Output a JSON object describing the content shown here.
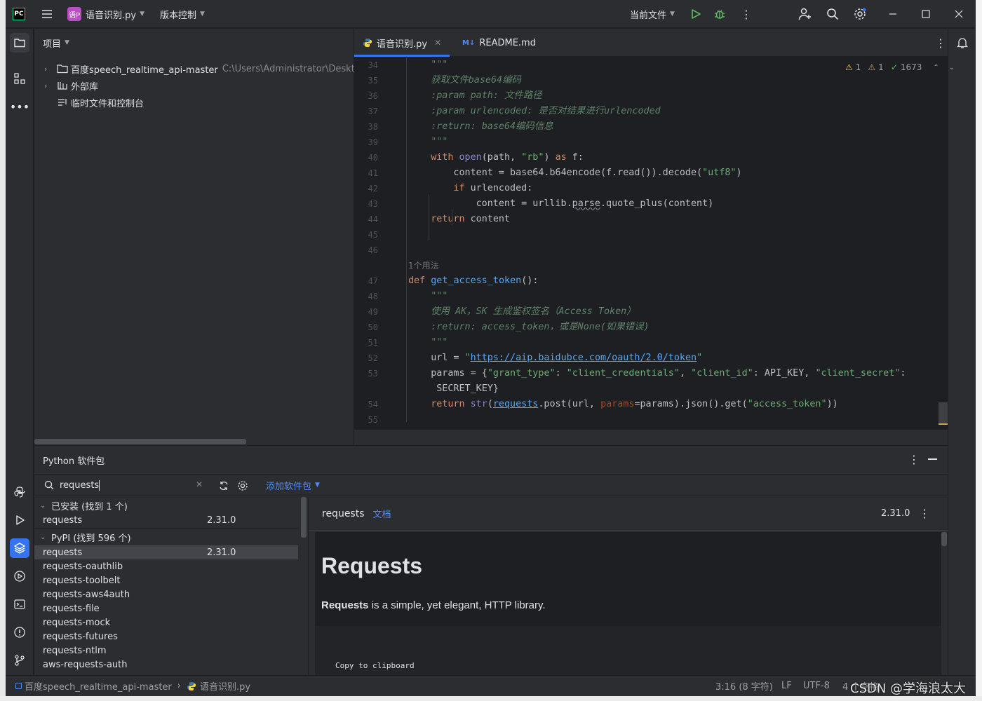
{
  "titlebar": {
    "app_icon": "pycharm-logo",
    "project_badge": "语P",
    "file_title": "语音识别.py",
    "vcs_menu": "版本控制",
    "run_config": "当前文件"
  },
  "project_panel": {
    "title": "项目",
    "tree": [
      {
        "label": "百度speech_realtime_api-master",
        "path": "C:\\Users\\Administrator\\Desktop"
      },
      {
        "label": "外部库"
      },
      {
        "label": "临时文件和控制台"
      }
    ]
  },
  "editor": {
    "tabs": [
      {
        "label": "语音识别.py"
      },
      {
        "label": "README.md"
      }
    ],
    "inspections": {
      "warnings": "1",
      "weak_warnings": "1",
      "ok": "1673"
    },
    "usage_hint": "1个用法",
    "lines": [
      {
        "n": "34",
        "text": "\"\"\""
      },
      {
        "n": "35",
        "text": "获取文件base64编码"
      },
      {
        "n": "36",
        "text": ":param path: 文件路径"
      },
      {
        "n": "37",
        "text": ":param urlencoded: 是否对结果进行urlencoded"
      },
      {
        "n": "38",
        "text": ":return: base64编码信息"
      },
      {
        "n": "39",
        "text": "\"\"\""
      },
      {
        "n": "40",
        "text": "with open(path, \"rb\") as f:"
      },
      {
        "n": "41",
        "text": "content = base64.b64encode(f.read()).decode(\"utf8\")"
      },
      {
        "n": "42",
        "text": "if urlencoded:"
      },
      {
        "n": "43",
        "text": "content = urllib.parse.quote_plus(content)"
      },
      {
        "n": "44",
        "text": "return content"
      },
      {
        "n": "45",
        "text": ""
      },
      {
        "n": "46",
        "text": ""
      },
      {
        "n": "47",
        "text": "def get_access_token():"
      },
      {
        "n": "48",
        "text": "\"\"\""
      },
      {
        "n": "49",
        "text": "使用 AK，SK 生成鉴权签名（Access Token）"
      },
      {
        "n": "50",
        "text": ":return: access_token，或是None(如果错误)"
      },
      {
        "n": "51",
        "text": "\"\"\""
      },
      {
        "n": "52",
        "text": "url = \"https://aip.baidubce.com/oauth/2.0/token\""
      },
      {
        "n": "53",
        "text": "params = {\"grant_type\": \"client_credentials\", \"client_id\": API_KEY, \"client_secret\":"
      },
      {
        "n": "",
        "text": "SECRET_KEY}"
      },
      {
        "n": "54",
        "text": "return str(requests.post(url, params=params).json().get(\"access_token\"))"
      },
      {
        "n": "55",
        "text": ""
      }
    ],
    "tokens": {
      "url": "https://aip.baidubce.com/oauth/2.0/token",
      "s_rb": "\"rb\"",
      "s_utf8": "\"utf8\"",
      "s_grant": "\"grant_type\"",
      "s_cc": "\"client_credentials\"",
      "s_cid": "\"client_id\"",
      "s_cs": "\"client_secret\"",
      "s_at": "\"access_token\""
    }
  },
  "packages": {
    "title": "Python 软件包",
    "search_value": "requests",
    "add_package": "添加软件包",
    "installed_header": "已安装 (找到 1 个)",
    "installed": [
      {
        "name": "requests",
        "version": "2.31.0"
      }
    ],
    "pypi_header": "PyPI (找到 596 个)",
    "pypi": [
      {
        "name": "requests",
        "version": "2.31.0"
      },
      {
        "name": "requests-oauthlib",
        "version": ""
      },
      {
        "name": "requests-toolbelt",
        "version": ""
      },
      {
        "name": "requests-aws4auth",
        "version": ""
      },
      {
        "name": "requests-file",
        "version": ""
      },
      {
        "name": "requests-mock",
        "version": ""
      },
      {
        "name": "requests-futures",
        "version": ""
      },
      {
        "name": "requests-ntlm",
        "version": ""
      },
      {
        "name": "aws-requests-auth",
        "version": ""
      }
    ],
    "detail": {
      "name": "requests",
      "docs_link": "文档",
      "version": "2.31.0",
      "heading": "Requests",
      "desc_bold": "Requests",
      "desc_rest": " is a simple, yet elegant, HTTP library.",
      "copy_label": "Copy to clipboard"
    }
  },
  "status": {
    "crumb_project": "百度speech_realtime_api-master",
    "crumb_file": "语音识别.py",
    "position": "3:16 (8 字符)",
    "line_sep": "LF",
    "encoding": "UTF-8",
    "indent": "4 个空格"
  },
  "watermark": "CSDN @学海浪太大",
  "colors": {
    "accent": "#3574f0",
    "keyword": "#cf8e6d",
    "string": "#6aab73",
    "function": "#56a8f5",
    "docstring": "#5f826b"
  }
}
